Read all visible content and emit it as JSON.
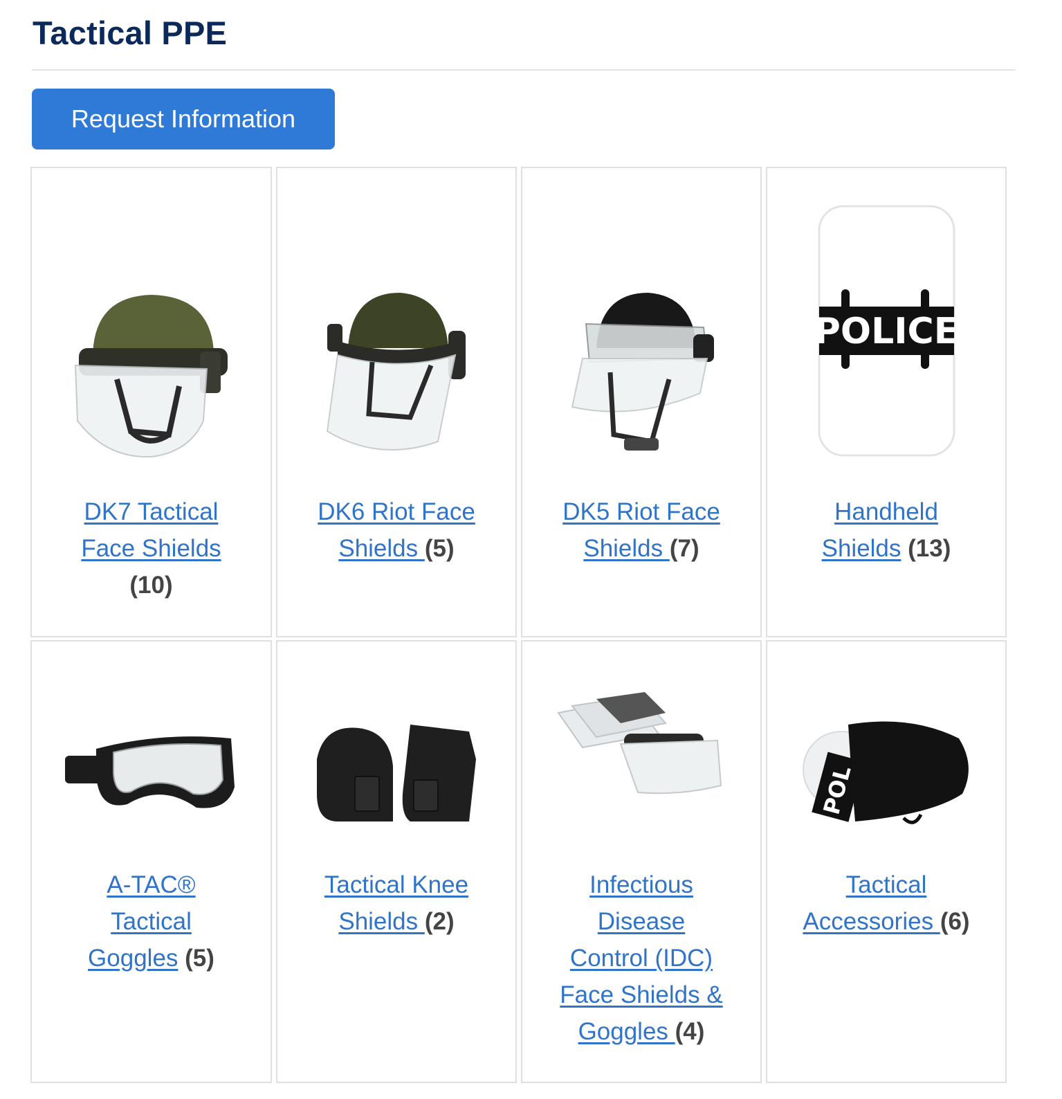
{
  "page": {
    "title": "Tactical PPE",
    "request_button_label": "Request Information"
  },
  "products": [
    {
      "line1": "DK7 Tactical",
      "line2": "Face Shields",
      "count": "(10)",
      "icon": "helmet-face-shield-green"
    },
    {
      "line1": "DK6 Riot Face",
      "line2": "Shields ",
      "count": "(5)",
      "icon": "helmet-face-shield-olive"
    },
    {
      "line1": "DK5 Riot Face",
      "line2": "Shields ",
      "count": "(7)",
      "icon": "helmet-face-shield-black"
    },
    {
      "line1": "Handheld",
      "line2": "Shields",
      "count": "(13)",
      "icon": "police-shield",
      "shield_text": "POLICE"
    },
    {
      "line1": "A-TAC®",
      "line2": "Tactical",
      "line3": "Goggles",
      "count": "(5)",
      "icon": "tactical-goggles"
    },
    {
      "line1": "Tactical Knee",
      "line2": "Shields ",
      "count": "(2)",
      "icon": "knee-shields"
    },
    {
      "line1": "Infectious",
      "line2": "Disease",
      "line3": "Control (IDC)",
      "line4": "Face Shields &",
      "line5": "Goggles ",
      "count": "(4)",
      "icon": "idc-face-shields"
    },
    {
      "line1": "Tactical",
      "line2": "Accessories ",
      "count": "(6)",
      "icon": "shield-carry-bag",
      "bag_text": "POL"
    }
  ],
  "colors": {
    "title": "#0b2a5b",
    "button": "#2f7ad6",
    "link": "#2f74c9"
  }
}
